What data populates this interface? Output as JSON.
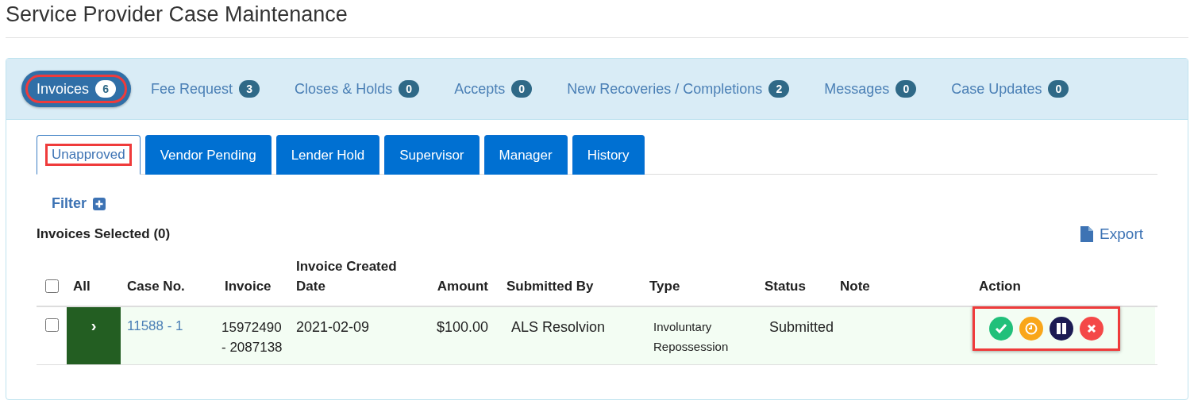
{
  "page_title": "Service Provider Case Maintenance",
  "main_tabs": [
    {
      "label": "Invoices",
      "count": "6",
      "selected": true,
      "highlighted": true
    },
    {
      "label": "Fee Request",
      "count": "3",
      "selected": false,
      "highlighted": false
    },
    {
      "label": "Closes & Holds",
      "count": "0",
      "selected": false,
      "highlighted": false
    },
    {
      "label": "Accepts",
      "count": "0",
      "selected": false,
      "highlighted": false
    },
    {
      "label": "New Recoveries / Completions",
      "count": "2",
      "selected": false,
      "highlighted": false
    },
    {
      "label": "Messages",
      "count": "0",
      "selected": false,
      "highlighted": false
    },
    {
      "label": "Case Updates",
      "count": "0",
      "selected": false,
      "highlighted": false
    }
  ],
  "sub_tabs": [
    {
      "label": "Unapproved",
      "selected": true,
      "highlighted": true
    },
    {
      "label": "Vendor Pending",
      "selected": false,
      "highlighted": false
    },
    {
      "label": "Lender Hold",
      "selected": false,
      "highlighted": false
    },
    {
      "label": "Supervisor",
      "selected": false,
      "highlighted": false
    },
    {
      "label": "Manager",
      "selected": false,
      "highlighted": false
    },
    {
      "label": "History",
      "selected": false,
      "highlighted": false
    }
  ],
  "filter": {
    "label": "Filter"
  },
  "selection_summary": "Invoices Selected (0)",
  "export": {
    "label": "Export"
  },
  "table": {
    "select_all": {
      "label": "All",
      "checked": false
    },
    "columns": [
      "Case No.",
      "Invoice",
      "Invoice Created Date",
      "Amount",
      "Submitted By",
      "Type",
      "Status",
      "Note",
      "Action"
    ],
    "rows": [
      {
        "checked": false,
        "expand": "›",
        "case_no": "11588 - 1",
        "invoice": "15972490 - 2087138",
        "created": "2021-02-09",
        "amount": "$100.00",
        "submitted_by": "ALS Resolvion",
        "type": "Involuntary Repossession",
        "status": "Submitted",
        "actions_highlighted": true,
        "actions": [
          {
            "kind": "approve"
          },
          {
            "kind": "pending"
          },
          {
            "kind": "hold"
          },
          {
            "kind": "reject"
          }
        ]
      }
    ]
  }
}
